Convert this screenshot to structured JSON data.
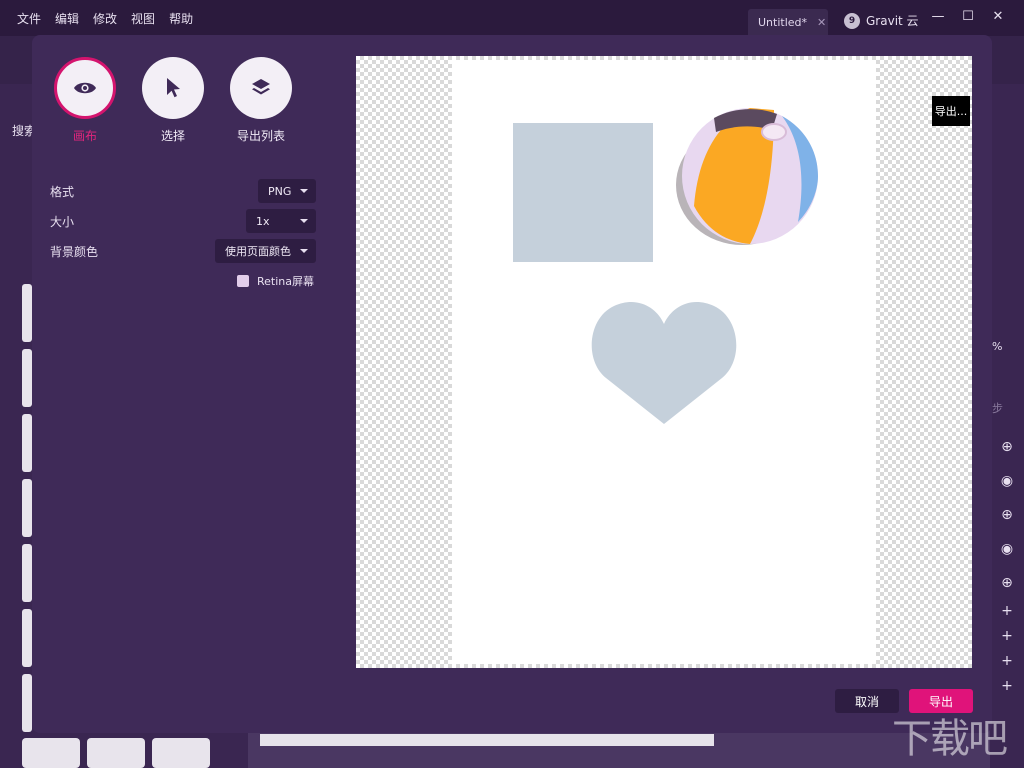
{
  "titlebar": {
    "menu": [
      "文件",
      "编辑",
      "修改",
      "视图",
      "帮助"
    ],
    "tab_title": "Untitled*",
    "cloud_label": "Gravit 云",
    "cloud_badge": "9"
  },
  "background": {
    "search_label": "搜索",
    "percent_label": "%",
    "sync_label": "步"
  },
  "dialog": {
    "modes": [
      {
        "label": "画布",
        "icon": "eye-icon",
        "active": true
      },
      {
        "label": "选择",
        "icon": "cursor-icon",
        "active": false
      },
      {
        "label": "导出列表",
        "icon": "layers-icon",
        "active": false
      }
    ],
    "format": {
      "label": "格式",
      "value": "PNG"
    },
    "size": {
      "label": "大小",
      "value": "1x"
    },
    "bg_color": {
      "label": "背景颜色",
      "value": "使用页面颜色"
    },
    "retina_label": "Retina屏幕",
    "preview_tooltip": "导出...",
    "cancel_label": "取消",
    "export_label": "导出"
  },
  "watermark": "下载吧",
  "colors": {
    "accent": "#e0137a",
    "dialog_bg": "#3f2a58",
    "shape_fill": "#c5d0db"
  }
}
